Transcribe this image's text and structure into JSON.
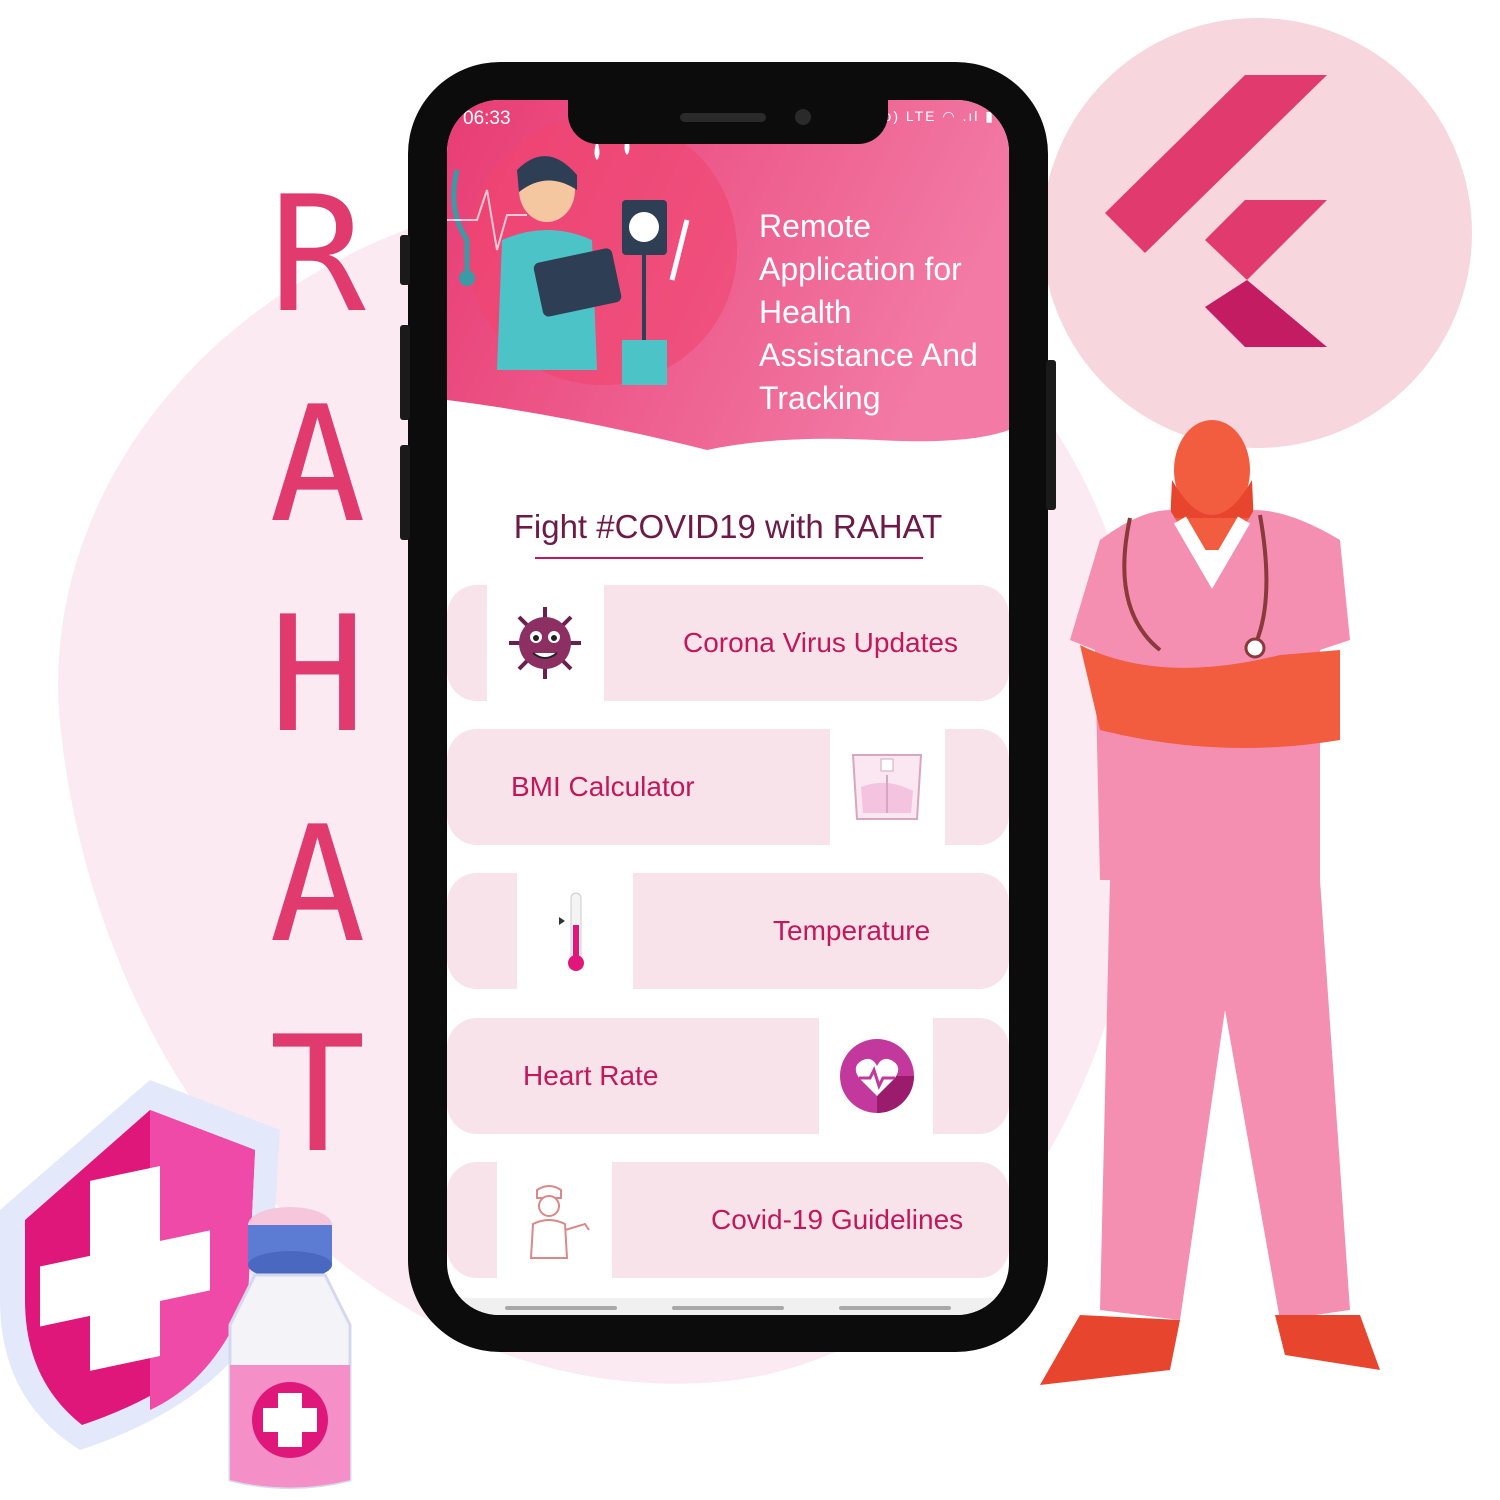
{
  "branding": {
    "letters": [
      "R",
      "A",
      "H",
      "A",
      "T"
    ],
    "accent_color": "#e03a6f",
    "primary_color": "#c2185b",
    "card_color": "#f9e3ea",
    "header_gradient": [
      "#e83c74",
      "#f27aa4"
    ]
  },
  "status_bar": {
    "time": "06:33",
    "icons": "✱ Vo) LTE ◠ .ıl ▮"
  },
  "header": {
    "subtitle": "Remote Application for Health Assistance And Tracking"
  },
  "slogan": "Fight #COVID19 with RAHAT",
  "menu": [
    {
      "label": "Corona Virus Updates",
      "icon": "virus-icon"
    },
    {
      "label": "BMI Calculator",
      "icon": "weighing-scale-icon"
    },
    {
      "label": "Temperature",
      "icon": "thermometer-icon"
    },
    {
      "label": "Heart Rate",
      "icon": "heart-rate-icon"
    },
    {
      "label": "Covid-19 Guidelines",
      "icon": "nurse-guide-icon"
    }
  ],
  "decorations": [
    "flutter-logo",
    "doctor-illustration",
    "shield-cross-icon",
    "vaccine-vial-icon",
    "nurse-illustration"
  ]
}
